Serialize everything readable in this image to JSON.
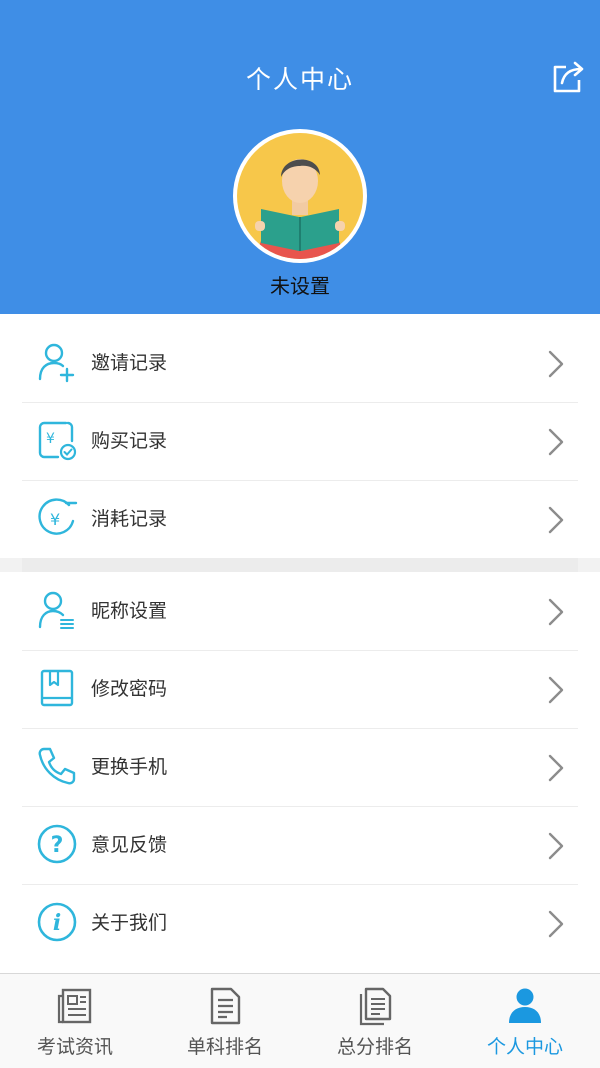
{
  "header": {
    "title": "个人中心",
    "share_icon": "share-icon"
  },
  "profile": {
    "nickname": "未设置",
    "avatar_icon": "reader-avatar"
  },
  "menu_group_1": [
    {
      "label": "邀请记录",
      "icon": "add-user-icon"
    },
    {
      "label": "购买记录",
      "icon": "yuan-purchase-icon"
    },
    {
      "label": "消耗记录",
      "icon": "yuan-consume-icon"
    }
  ],
  "menu_group_2": [
    {
      "label": "昵称设置",
      "icon": "user-edit-icon"
    },
    {
      "label": "修改密码",
      "icon": "book-lock-icon"
    },
    {
      "label": "更换手机",
      "icon": "phone-icon"
    },
    {
      "label": "意见反馈",
      "icon": "question-icon"
    },
    {
      "label": "关于我们",
      "icon": "info-icon"
    }
  ],
  "tabs": [
    {
      "label": "考试资讯",
      "icon": "news-icon",
      "active": false
    },
    {
      "label": "单科排名",
      "icon": "document-icon",
      "active": false
    },
    {
      "label": "总分排名",
      "icon": "documents-icon",
      "active": false
    },
    {
      "label": "个人中心",
      "icon": "person-icon",
      "active": true
    }
  ],
  "colors": {
    "header_bg": "#3f8ee6",
    "icon_accent": "#2fb6dc",
    "tab_active": "#1b98e0"
  }
}
